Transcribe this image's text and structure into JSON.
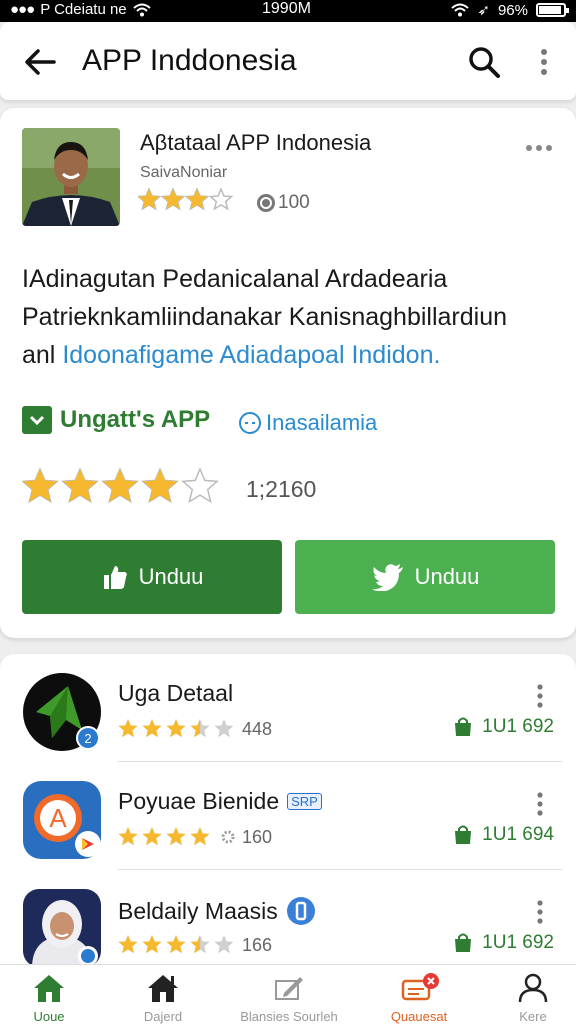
{
  "status_bar": {
    "carrier": "P Cdeiatu ne",
    "time": "1990M",
    "battery": "96%",
    "battery_level": 0.9
  },
  "app_bar": {
    "title": "APP Inddonesia",
    "icons": [
      "back-arrow-icon",
      "search-icon",
      "more-vert-icon"
    ]
  },
  "detail": {
    "title": "Aβtataal APP Indonesia",
    "developer": "SaivaNoniar",
    "rating_stars": 3,
    "review_count": "100",
    "description_lines": [
      "IAdinagutan  Pedanicalanal Ardadearia",
      "Patrieknkamliindanakar Kanisnaghbillardiun",
      "anl"
    ],
    "description_link": "Idoonafigame Adiadapoal Indidon.",
    "tag_green": "Ungatt's  APP",
    "tag_blue": "Inasailamia",
    "big_rating_stars": 4,
    "big_count": "1;2160",
    "button_1_label": "Unduu",
    "button_2_label": "Unduu",
    "colors": {
      "primary_green": "#2e7d32",
      "light_green": "#4caf50",
      "link_blue": "#2a8bd0",
      "star_gold": "#f5b82e"
    }
  },
  "list": [
    {
      "name": "Uga Detaal",
      "badge": "2",
      "stars": 3.5,
      "count": "448",
      "downloads": "1U1 692"
    },
    {
      "name": "Poyuae Bienide",
      "badge_label": "SRP",
      "stars": 4,
      "count": "160",
      "downloads": "1U1 694"
    },
    {
      "name": "Beldaily Maasis",
      "badge_label": "0",
      "stars": 3.5,
      "count": "166",
      "downloads": "1U1 692"
    }
  ],
  "bottom_nav": [
    {
      "label": "Uoue"
    },
    {
      "label": "Dajerd"
    },
    {
      "label": "Blansies Sourleh"
    },
    {
      "label": "Quauesat"
    },
    {
      "label": "Kere"
    }
  ]
}
